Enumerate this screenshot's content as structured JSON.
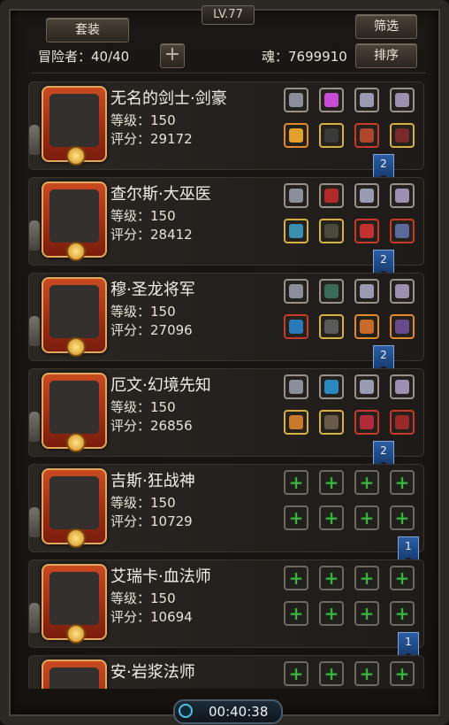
{
  "header": {
    "level": "LV.77",
    "suit_label": "套装",
    "filter_label": "筛选",
    "sort_label": "排序",
    "adventurer_label": "冒险者：40/40",
    "plus_label": "+",
    "soul_label": "魂：7699910"
  },
  "heroes": [
    {
      "name": "无名的剑士·剑豪",
      "level": "等级：150",
      "score": "评分：29172",
      "flag": "2",
      "slots_top": [
        "silver",
        "pink",
        "silver",
        "silver"
      ],
      "slots_bottom": [
        "orange",
        "yellow",
        "red",
        "yellow"
      ],
      "colors_top": [
        "#8a8f99",
        "#c84bd6",
        "#9a9ab2",
        "#9c8fb0"
      ],
      "colors_bottom": [
        "#e3a12c",
        "#3a3a3a",
        "#b0462c",
        "#7a2a2a"
      ]
    },
    {
      "name": "查尔斯·大巫医",
      "level": "等级：150",
      "score": "评分：28412",
      "flag": "2",
      "slots_top": [
        "silver",
        "silver",
        "silver",
        "silver"
      ],
      "slots_bottom": [
        "yellow",
        "yellow",
        "red",
        "red"
      ],
      "colors_top": [
        "#8a8f99",
        "#b02a2a",
        "#9a9ab2",
        "#9c8fb0"
      ],
      "colors_bottom": [
        "#3a8fb0",
        "#4a4a3a",
        "#c23030",
        "#5a6a9a"
      ]
    },
    {
      "name": "穆·圣龙将军",
      "level": "等级：150",
      "score": "评分：27096",
      "flag": "2",
      "slots_top": [
        "silver",
        "silver",
        "silver",
        "silver"
      ],
      "slots_bottom": [
        "red",
        "yellow",
        "orange",
        "orange"
      ],
      "colors_top": [
        "#8a8f99",
        "#3a6a5a",
        "#9a9ab2",
        "#9c8fb0"
      ],
      "colors_bottom": [
        "#2a7ab8",
        "#5a5a5a",
        "#c86a2a",
        "#6a4a8a"
      ]
    },
    {
      "name": "厄文·幻境先知",
      "level": "等级：150",
      "score": "评分：26856",
      "flag": "2",
      "slots_top": [
        "silver",
        "silver",
        "silver",
        "silver"
      ],
      "slots_bottom": [
        "yellow",
        "yellow",
        "red",
        "red"
      ],
      "colors_top": [
        "#8a8f99",
        "#2a8ac0",
        "#9a9ab2",
        "#9c8fb0"
      ],
      "colors_bottom": [
        "#c87a2a",
        "#6a5a4a",
        "#b02a3a",
        "#9a2a2a"
      ]
    },
    {
      "name": "吉斯·狂战神",
      "level": "等级：150",
      "score": "评分：10729",
      "flag": "1",
      "slots_top": [
        "empty",
        "empty",
        "empty",
        "empty"
      ],
      "slots_bottom": [
        "empty",
        "empty",
        "empty",
        "empty"
      ],
      "colors_top": [],
      "colors_bottom": []
    },
    {
      "name": "艾瑞卡·血法师",
      "level": "等级：150",
      "score": "评分：10694",
      "flag": "1",
      "slots_top": [
        "empty",
        "empty",
        "empty",
        "empty"
      ],
      "slots_bottom": [
        "empty",
        "empty",
        "empty",
        "empty"
      ],
      "colors_top": [],
      "colors_bottom": []
    },
    {
      "name": "安·岩浆法师",
      "level": "",
      "score": "",
      "flag": "",
      "slots_top": [
        "empty",
        "empty",
        "empty",
        "empty"
      ],
      "slots_bottom": [],
      "colors_top": [],
      "colors_bottom": []
    }
  ],
  "timer": {
    "time": "00:40:38",
    "icon": "clock-ring-icon"
  },
  "colors": {
    "frame": "#2c2824",
    "flag": "#2b5ea5",
    "empty_plus": "#38b23a"
  }
}
